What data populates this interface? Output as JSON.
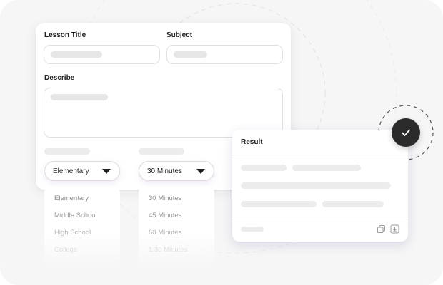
{
  "form": {
    "lesson_title_label": "Lesson Title",
    "subject_label": "Subject",
    "describe_label": "Describe"
  },
  "selects": {
    "grade": {
      "value": "Elementary",
      "options": [
        "Elementary",
        "Middle School",
        "High School",
        "College"
      ]
    },
    "duration": {
      "value": "30 Minutes",
      "options": [
        "30 Minutes",
        "45 Minutes",
        "60 Minutes",
        "1:30 Minutes"
      ]
    }
  },
  "result": {
    "title": "Result"
  },
  "icons": {
    "dropdown": "chevron-down-icon",
    "copy": "copy-icon",
    "download": "download-icon",
    "status": "check-icon"
  },
  "colors": {
    "card_background": "#ffffff",
    "stage_background": "#f6f6f7",
    "badge": "#2b2b2b",
    "placeholder": "#e6e6e6",
    "menu_text_fade": "#a0a0a0"
  }
}
